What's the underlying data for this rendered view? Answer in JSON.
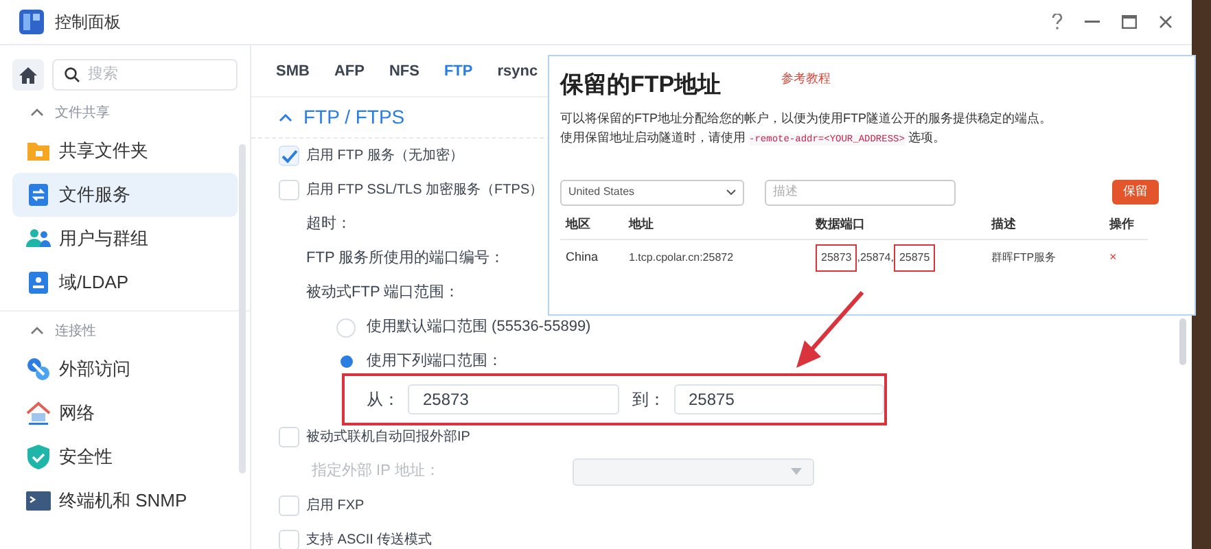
{
  "window": {
    "title": "控制面板"
  },
  "search": {
    "placeholder": "搜索"
  },
  "sidebar": {
    "sections": [
      {
        "title": "文件共享",
        "expanded": true,
        "items": [
          {
            "label": "共享文件夹",
            "selected": false
          },
          {
            "label": "文件服务",
            "selected": true
          },
          {
            "label": "用户与群组",
            "selected": false
          },
          {
            "label": "域/LDAP",
            "selected": false
          }
        ]
      },
      {
        "title": "连接性",
        "expanded": true,
        "items": [
          {
            "label": "外部访问",
            "selected": false
          },
          {
            "label": "网络",
            "selected": false
          },
          {
            "label": "安全性",
            "selected": false
          },
          {
            "label": "终端机和 SNMP",
            "selected": false
          }
        ]
      }
    ]
  },
  "tabs": [
    {
      "label": "SMB",
      "selected": false
    },
    {
      "label": "AFP",
      "selected": false
    },
    {
      "label": "NFS",
      "selected": false
    },
    {
      "label": "FTP",
      "selected": true
    },
    {
      "label": "rsync",
      "selected": false
    }
  ],
  "section": {
    "title": "FTP / FTPS",
    "expanded": true
  },
  "settings": [
    {
      "kind": "checkbox",
      "label": "启用 FTP 服务（无加密）",
      "checked": true,
      "disabled": false
    },
    {
      "kind": "checkbox",
      "label": "启用 FTP SSL/TLS 加密服务（FTPS）",
      "checked": false,
      "disabled": false
    },
    {
      "kind": "label",
      "label": "超时："
    },
    {
      "kind": "label",
      "label": "FTP 服务所使用的端口编号："
    },
    {
      "kind": "label",
      "label": "被动式FTP 端口范围："
    },
    {
      "kind": "radio",
      "label": "使用默认端口范围 (55536-55899)",
      "selected": false
    },
    {
      "kind": "radio",
      "label": "使用下列端口范围：",
      "selected": true
    },
    {
      "kind": "range",
      "from_label": "从：",
      "from": "25873",
      "to_label": "到：",
      "to": "25875",
      "highlighted": true
    },
    {
      "kind": "checkbox",
      "label": "被动式联机自动回报外部IP",
      "checked": false,
      "disabled": false
    },
    {
      "kind": "select",
      "label": "指定外部 IP 地址：",
      "disabled": true
    },
    {
      "kind": "checkbox",
      "label": "启用 FXP",
      "checked": false,
      "disabled": false
    },
    {
      "kind": "checkbox",
      "label": "支持 ASCII 传送模式",
      "checked": false,
      "disabled": false
    }
  ],
  "popup": {
    "title": "保留的FTP地址",
    "link": "参考教程",
    "description": {
      "before": "可以将保留的FTP地址分配给您的帐户，以便为使用FTP隧道公开的服务提供稳定的端点。使用保留地址启动隧道时，请使用 ",
      "code": "-remote-addr=<YOUR_ADDRESS>",
      "after": " 选项。"
    },
    "region_select": "United States",
    "description_placeholder": "描述",
    "button": "保留",
    "table": {
      "columns": [
        "地区",
        "地址",
        "数据端口",
        "描述",
        "操作"
      ],
      "rows": [
        {
          "region": "China",
          "address": "1.tcp.cpolar.cn:25872",
          "ports": [
            {
              "text": "25873",
              "highlighted": true
            },
            {
              "text": ",25874,",
              "highlighted": false
            },
            {
              "text": "25875",
              "highlighted": true
            }
          ],
          "description": "群晖FTP服务",
          "action": "×"
        }
      ]
    }
  }
}
